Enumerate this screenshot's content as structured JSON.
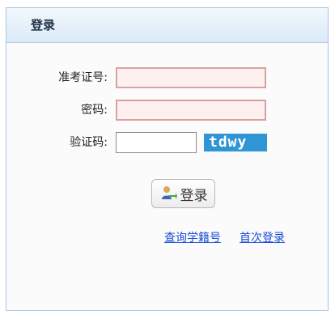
{
  "panel": {
    "title": "登录"
  },
  "form": {
    "exam_id_label": "准考证号:",
    "exam_id_value": "",
    "password_label": "密码:",
    "password_value": "",
    "captcha_label": "验证码:",
    "captcha_value": "",
    "captcha_text": "tdwy"
  },
  "buttons": {
    "login_label": "登录"
  },
  "links": {
    "query_label": "查询学籍号",
    "first_login_label": "首次登录"
  },
  "colors": {
    "header_blue": "#dbe9f7",
    "captcha_bg": "#2f95d4",
    "link": "#1a4dd8",
    "input_pink": "#fff0f0"
  }
}
